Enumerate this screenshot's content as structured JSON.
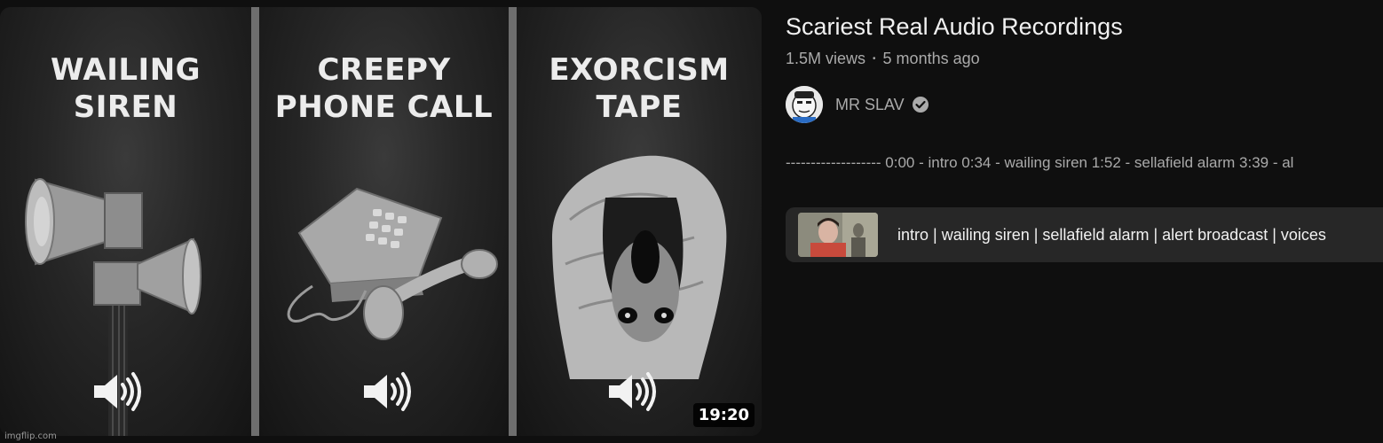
{
  "thumbnail": {
    "panels": [
      {
        "line1": "WAILING",
        "line2": "SIREN",
        "icon": "siren-icon"
      },
      {
        "line1": "CREEPY",
        "line2": "PHONE CALL",
        "icon": "telephone-icon"
      },
      {
        "line1": "EXORCISM",
        "line2": "TAPE",
        "icon": "possessed-face-icon"
      }
    ],
    "audio_icon": "speaker-volume-icon",
    "duration": "19:20",
    "watermark": "imgflip.com"
  },
  "video": {
    "title": "Scariest Real Audio Recordings",
    "views": "1.5M views",
    "separator": "•",
    "age": "5 months ago"
  },
  "channel": {
    "name": "MR SLAV",
    "verified_icon": "verified-check-icon",
    "avatar_icon": "channel-avatar"
  },
  "description": {
    "text": "------------------- 0:00 - intro 0:34 - wailing siren 1:52 - sellafield alarm 3:39 - al"
  },
  "chapters": {
    "text": "intro | wailing siren | sellafield alarm | alert broadcast | voices"
  },
  "colors": {
    "background": "#0f0f0f",
    "text_primary": "#f1f1f1",
    "text_secondary": "#aaaaaa",
    "chapter_bg": "#272727"
  }
}
